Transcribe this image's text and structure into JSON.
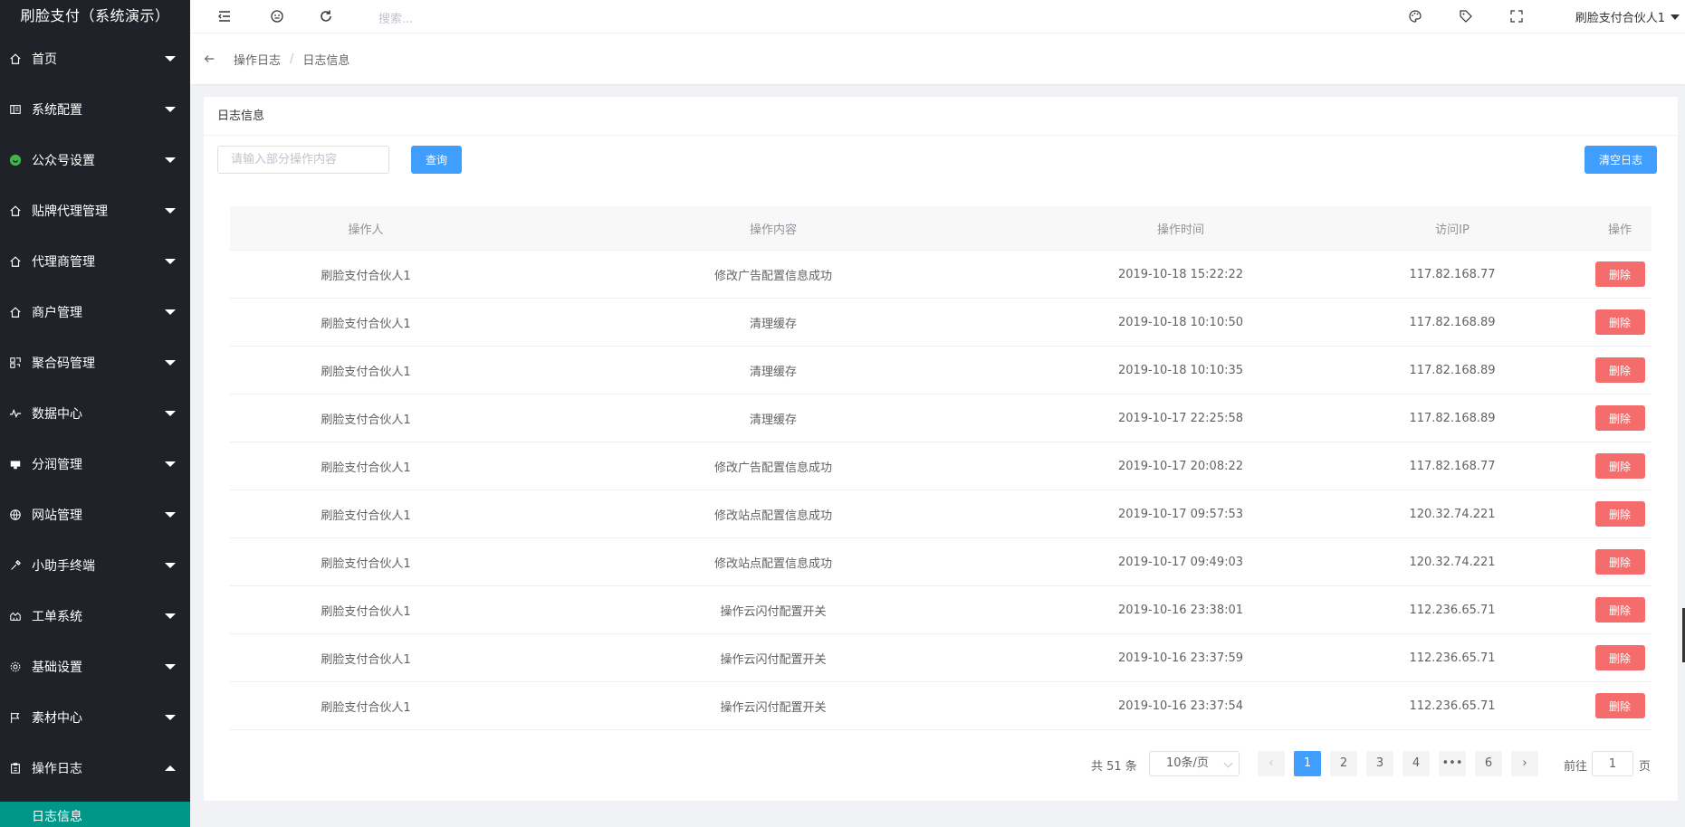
{
  "brand": "刷脸支付（系统演示）",
  "sidebar": {
    "items": [
      {
        "label": "首页",
        "icon": "home-icon"
      },
      {
        "label": "系统配置",
        "icon": "config-icon"
      },
      {
        "label": "公众号设置",
        "icon": "wechat-icon"
      },
      {
        "label": "贴牌代理管理",
        "icon": "home-icon"
      },
      {
        "label": "代理商管理",
        "icon": "home-icon"
      },
      {
        "label": "商户管理",
        "icon": "home-icon"
      },
      {
        "label": "聚合码管理",
        "icon": "qr-icon"
      },
      {
        "label": "数据中心",
        "icon": "pulse-icon"
      },
      {
        "label": "分润管理",
        "icon": "card-icon"
      },
      {
        "label": "网站管理",
        "icon": "globe-icon"
      },
      {
        "label": "小助手终端",
        "icon": "tool-icon"
      },
      {
        "label": "工单系统",
        "icon": "ticket-icon"
      },
      {
        "label": "基础设置",
        "icon": "gear-icon"
      },
      {
        "label": "素材中心",
        "icon": "flag-icon"
      },
      {
        "label": "操作日志",
        "icon": "clipboard-icon"
      }
    ],
    "active_sub": "日志信息"
  },
  "header": {
    "search_placeholder": "搜索...",
    "user": "刷脸支付合伙人1"
  },
  "breadcrumb": {
    "parent": "操作日志",
    "separator": "/",
    "current": "日志信息"
  },
  "card": {
    "title": "日志信息",
    "filter_placeholder": "请输入部分操作内容",
    "query_label": "查询",
    "clear_label": "清空日志"
  },
  "table": {
    "headers": [
      "操作人",
      "操作内容",
      "操作时间",
      "访问IP",
      "操作"
    ],
    "delete_label": "删除",
    "rows": [
      {
        "operator": "刷脸支付合伙人1",
        "content": "修改广告配置信息成功",
        "time": "2019-10-18 15:22:22",
        "ip": "117.82.168.77"
      },
      {
        "operator": "刷脸支付合伙人1",
        "content": "清理缓存",
        "time": "2019-10-18 10:10:50",
        "ip": "117.82.168.89"
      },
      {
        "operator": "刷脸支付合伙人1",
        "content": "清理缓存",
        "time": "2019-10-18 10:10:35",
        "ip": "117.82.168.89"
      },
      {
        "operator": "刷脸支付合伙人1",
        "content": "清理缓存",
        "time": "2019-10-17 22:25:58",
        "ip": "117.82.168.89"
      },
      {
        "operator": "刷脸支付合伙人1",
        "content": "修改广告配置信息成功",
        "time": "2019-10-17 20:08:22",
        "ip": "117.82.168.77"
      },
      {
        "operator": "刷脸支付合伙人1",
        "content": "修改站点配置信息成功",
        "time": "2019-10-17 09:57:53",
        "ip": "120.32.74.221"
      },
      {
        "operator": "刷脸支付合伙人1",
        "content": "修改站点配置信息成功",
        "time": "2019-10-17 09:49:03",
        "ip": "120.32.74.221"
      },
      {
        "operator": "刷脸支付合伙人1",
        "content": "操作云闪付配置开关",
        "time": "2019-10-16 23:38:01",
        "ip": "112.236.65.71"
      },
      {
        "operator": "刷脸支付合伙人1",
        "content": "操作云闪付配置开关",
        "time": "2019-10-16 23:37:59",
        "ip": "112.236.65.71"
      },
      {
        "operator": "刷脸支付合伙人1",
        "content": "操作云闪付配置开关",
        "time": "2019-10-16 23:37:54",
        "ip": "112.236.65.71"
      }
    ]
  },
  "pagination": {
    "total": "共 51 条",
    "page_size": "10条/页",
    "pages": [
      "1",
      "2",
      "3",
      "4",
      "•••",
      "6"
    ],
    "current_page": "1",
    "goto_label": "前往",
    "goto_value": "1",
    "unit": "页"
  },
  "colors": {
    "sidebar_bg": "#20222a",
    "active_sub_bg": "#009688",
    "primary": "#409eff",
    "danger": "#f56c6c"
  }
}
